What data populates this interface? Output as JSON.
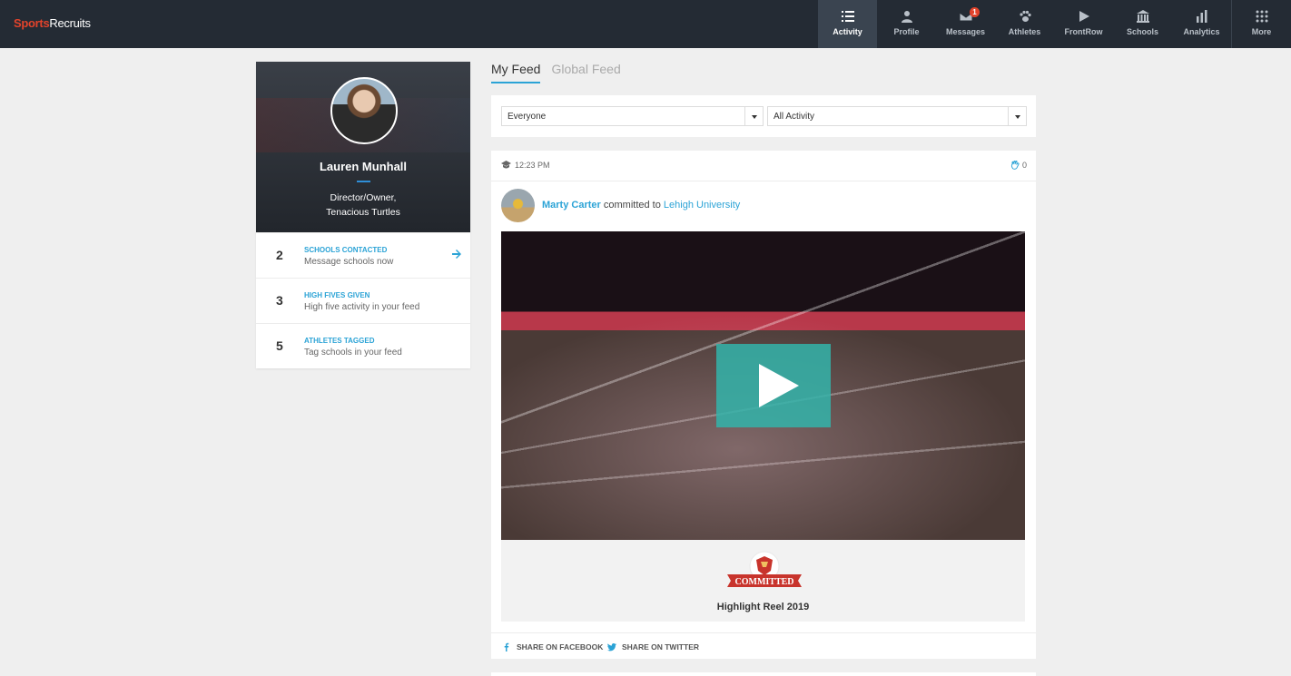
{
  "brand": {
    "part1": "Sports",
    "part2": "Recruits"
  },
  "nav": {
    "items": [
      {
        "label": "Activity",
        "icon": "list-icon"
      },
      {
        "label": "Profile",
        "icon": "person-icon"
      },
      {
        "label": "Messages",
        "icon": "envelope-icon",
        "badge": "1"
      },
      {
        "label": "Athletes",
        "icon": "paw-icon"
      },
      {
        "label": "FrontRow",
        "icon": "play-icon"
      },
      {
        "label": "Schools",
        "icon": "building-icon"
      },
      {
        "label": "Analytics",
        "icon": "bar-chart-icon"
      },
      {
        "label": "More",
        "icon": "grid-icon"
      }
    ]
  },
  "profile": {
    "name": "Lauren Munhall",
    "role_line1": "Director/Owner,",
    "role_line2": "Tenacious Turtles",
    "stats": [
      {
        "num": "2",
        "title": "SCHOOLS CONTACTED",
        "subtitle": "Message schools now"
      },
      {
        "num": "3",
        "title": "HIGH FIVES GIVEN",
        "subtitle": "High five activity in your feed"
      },
      {
        "num": "5",
        "title": "ATHLETES TAGGED",
        "subtitle": "Tag schools in your feed"
      }
    ]
  },
  "feed": {
    "tabs": [
      "My Feed",
      "Global Feed"
    ],
    "filters": {
      "audience": "Everyone",
      "activity": "All Activity"
    }
  },
  "post": {
    "time": "12:23 PM",
    "high_fives": "0",
    "athlete": "Marty Carter",
    "verb": "committed to",
    "school": "Lehigh University",
    "badge_text": "COMMITTED",
    "video_title": "Highlight Reel 2019",
    "share_facebook": "SHARE ON FACEBOOK",
    "share_twitter": "SHARE ON TWITTER"
  },
  "colors": {
    "accent": "#2ba3d6",
    "brand_red": "#e2432b",
    "nav_bg": "#242b34"
  }
}
